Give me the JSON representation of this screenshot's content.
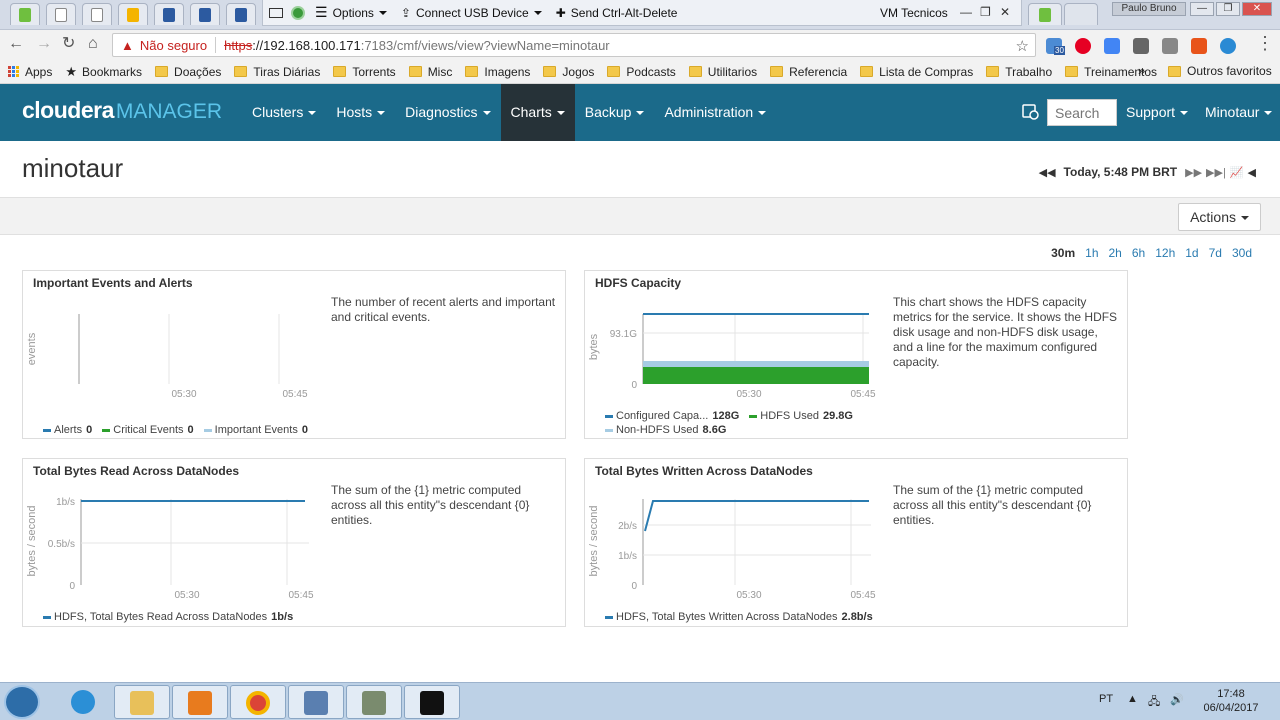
{
  "vm_bar": {
    "options_label": "Options",
    "usb_label": "Connect USB Device",
    "cad_label": "Send Ctrl-Alt-Delete",
    "title": "VM Tecnicos"
  },
  "browser": {
    "profile": "Paulo Bruno",
    "security_label": "Não seguro",
    "url_scheme": "https",
    "url_host": "://192.168.100.171",
    "url_path": ":7183/cmf/views/view?viewName=minotaur",
    "ext_badge": "30"
  },
  "bookmarks": {
    "apps": "Apps",
    "bookmarks": "Bookmarks",
    "folders": [
      "Doações",
      "Tiras Diárias",
      "Torrents",
      "Misc",
      "Imagens",
      "Jogos",
      "Podcasts",
      "Utilitarios",
      "Referencia",
      "Lista de Compras",
      "Trabalho",
      "Treinamentos"
    ],
    "more": "»",
    "other": "Outros favoritos"
  },
  "cm": {
    "logo_main": "cloudera",
    "logo_sub": "MANAGER",
    "menu": [
      "Clusters",
      "Hosts",
      "Diagnostics",
      "Charts",
      "Backup",
      "Administration"
    ],
    "search_placeholder": "Search",
    "support": "Support",
    "user": "Minotaur"
  },
  "page": {
    "title": "minotaur",
    "time": "Today, 5:48 PM BRT",
    "actions": "Actions",
    "ranges": [
      "30m",
      "1h",
      "2h",
      "6h",
      "12h",
      "1d",
      "7d",
      "30d"
    ],
    "selected_range": "30m"
  },
  "panels": [
    {
      "title": "Important Events and Alerts",
      "description": "The number of recent alerts and important and critical events.",
      "ylabel": "events",
      "xticks": [
        "05:30",
        "05:45"
      ],
      "legend": [
        {
          "name": "Alerts",
          "value": "0",
          "color": "#2a7bb0"
        },
        {
          "name": "Critical Events",
          "value": "0",
          "color": "#2ca02c"
        },
        {
          "name": "Important Events",
          "value": "0",
          "color": "#a6cce3"
        }
      ]
    },
    {
      "title": "HDFS Capacity",
      "description": "This chart shows the HDFS capacity metrics for the service. It shows the HDFS disk usage and non-HDFS disk usage, and a line for the maximum configured capacity.",
      "ylabel": "bytes",
      "yticks": [
        "93.1G",
        "0"
      ],
      "xticks": [
        "05:30",
        "05:45"
      ],
      "legend": [
        {
          "name": "Configured Capa...",
          "value": "128G",
          "color": "#2a7bb0"
        },
        {
          "name": "HDFS Used",
          "value": "29.8G",
          "color": "#2ca02c"
        },
        {
          "name": "Non-HDFS Used",
          "value": "8.6G",
          "color": "#a6cce3"
        }
      ]
    },
    {
      "title": "Total Bytes Read Across DataNodes",
      "description": "The sum of the {1} metric computed across all this entity\"s descendant {0} entities.",
      "ylabel": "bytes / second",
      "yticks": [
        "1b/s",
        "0.5b/s",
        "0"
      ],
      "xticks": [
        "05:30",
        "05:45"
      ],
      "legend": [
        {
          "name": "HDFS, Total Bytes Read Across DataNodes",
          "value": "1b/s",
          "color": "#2a7bb0"
        }
      ]
    },
    {
      "title": "Total Bytes Written Across DataNodes",
      "description": "The sum of the {1} metric computed across all this entity\"s descendant {0} entities.",
      "ylabel": "bytes / second",
      "yticks": [
        "2b/s",
        "1b/s",
        "0"
      ],
      "xticks": [
        "05:30",
        "05:45"
      ],
      "legend": [
        {
          "name": "HDFS, Total Bytes Written Across DataNodes",
          "value": "2.8b/s",
          "color": "#2a7bb0"
        }
      ]
    }
  ],
  "taskbar": {
    "lang": "PT",
    "time": "17:48",
    "date": "06/04/2017"
  }
}
